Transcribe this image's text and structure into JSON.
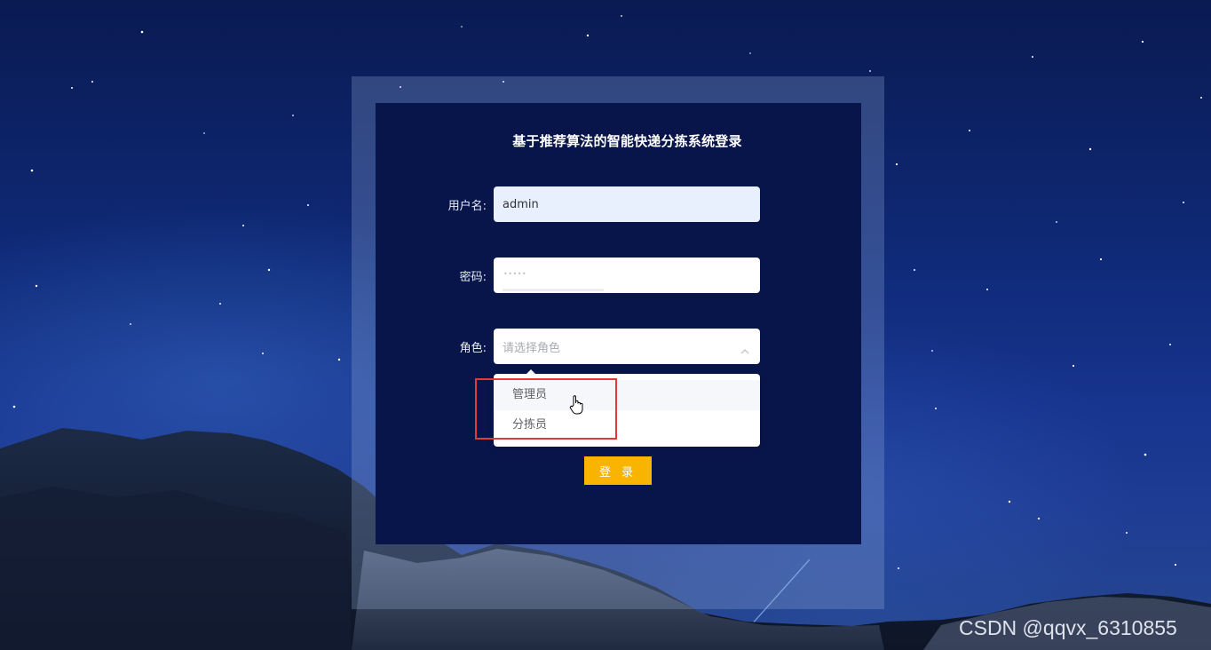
{
  "login": {
    "title": "基于推荐算法的智能快递分拣系统登录",
    "username_label": "用户名:",
    "username_value": "admin",
    "password_label": "密码:",
    "password_mask": "•••••",
    "role_label": "角色:",
    "role_placeholder": "请选择角色",
    "role_options": [
      "管理员",
      "分拣员"
    ],
    "login_button": "登 录"
  },
  "watermark": "CSDN @qqvx_6310855",
  "colors": {
    "panel": "#08154a",
    "button": "#f9b400",
    "highlight": "#e23a3a"
  }
}
